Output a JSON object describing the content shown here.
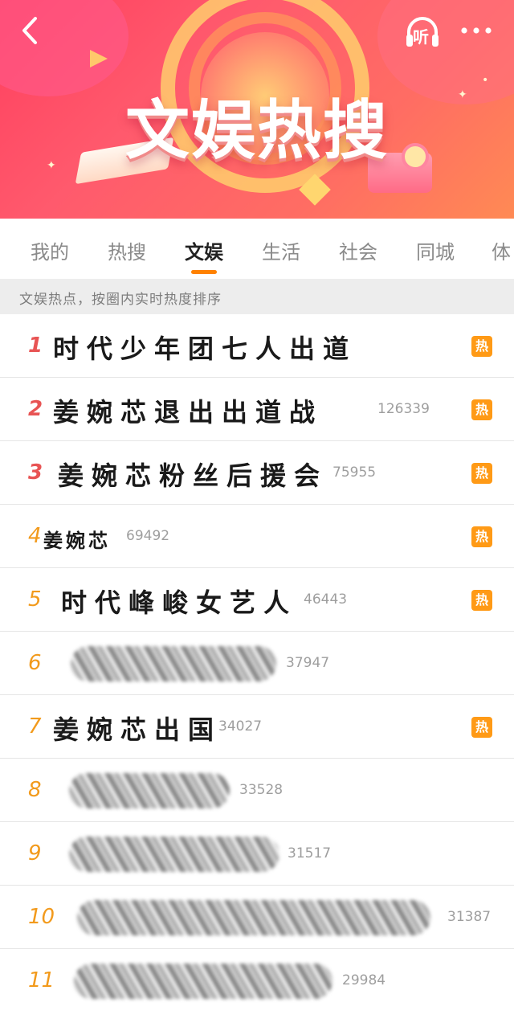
{
  "banner": {
    "title": "文娱热搜",
    "listen_label": "听"
  },
  "tabs": [
    {
      "label": "我的"
    },
    {
      "label": "热搜"
    },
    {
      "label": "文娱"
    },
    {
      "label": "生活"
    },
    {
      "label": "社会"
    },
    {
      "label": "同城"
    },
    {
      "label": "体"
    }
  ],
  "active_tab": "文娱",
  "tip": "文娱热点，按圈内实时热度排序",
  "hot_badge_label": "热",
  "colors": {
    "accent": "#ff8200",
    "rank_top": "#e85454",
    "rank_other": "#f29a1c",
    "hot_badge": "#ff9a16"
  },
  "items": [
    {
      "rank": "1",
      "title": "时代少年团七人出道",
      "count": "",
      "hot": true
    },
    {
      "rank": "2",
      "title": "姜婉芯退出出道战",
      "count": "126339",
      "hot": true
    },
    {
      "rank": "3",
      "title": "姜婉芯粉丝后援会",
      "count": "75955",
      "hot": true
    },
    {
      "rank": "4",
      "title": "姜婉芯",
      "count": "69492",
      "hot": true
    },
    {
      "rank": "5",
      "title": "时代峰峻女艺人",
      "count": "46443",
      "hot": true
    },
    {
      "rank": "6",
      "title": "",
      "count": "37947",
      "hot": false
    },
    {
      "rank": "7",
      "title": "姜婉芯出国",
      "count": "34027",
      "hot": true
    },
    {
      "rank": "8",
      "title": "",
      "count": "33528",
      "hot": false
    },
    {
      "rank": "9",
      "title": "",
      "count": "31517",
      "hot": false
    },
    {
      "rank": "10",
      "title": "",
      "count": "31387",
      "hot": false
    },
    {
      "rank": "11",
      "title": "",
      "count": "29984",
      "hot": false
    }
  ]
}
